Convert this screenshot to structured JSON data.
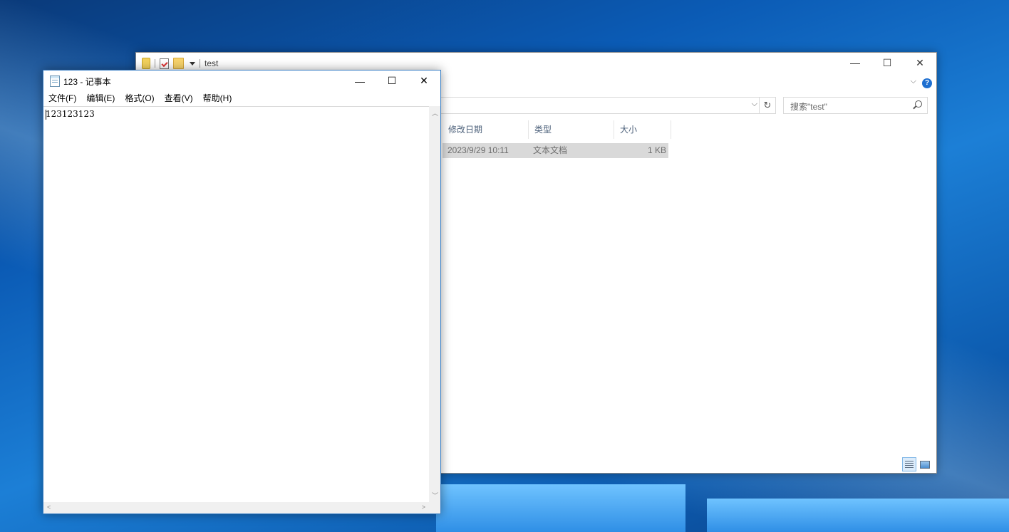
{
  "explorer": {
    "title": "test",
    "minimize": "—",
    "maximize": "☐",
    "close": "✕",
    "help": "?",
    "search_placeholder": "搜索\"test\"",
    "columns": [
      "修改日期",
      "类型",
      "大小"
    ],
    "file": {
      "date": "2023/9/29 10:11",
      "type": "文本文档",
      "size": "1 KB"
    }
  },
  "notepad": {
    "title": "123 - 记事本",
    "minimize": "—",
    "maximize": "☐",
    "close": "✕",
    "menu": [
      "文件(F)",
      "编辑(E)",
      "格式(O)",
      "查看(V)",
      "帮助(H)"
    ],
    "content": "123123123"
  }
}
